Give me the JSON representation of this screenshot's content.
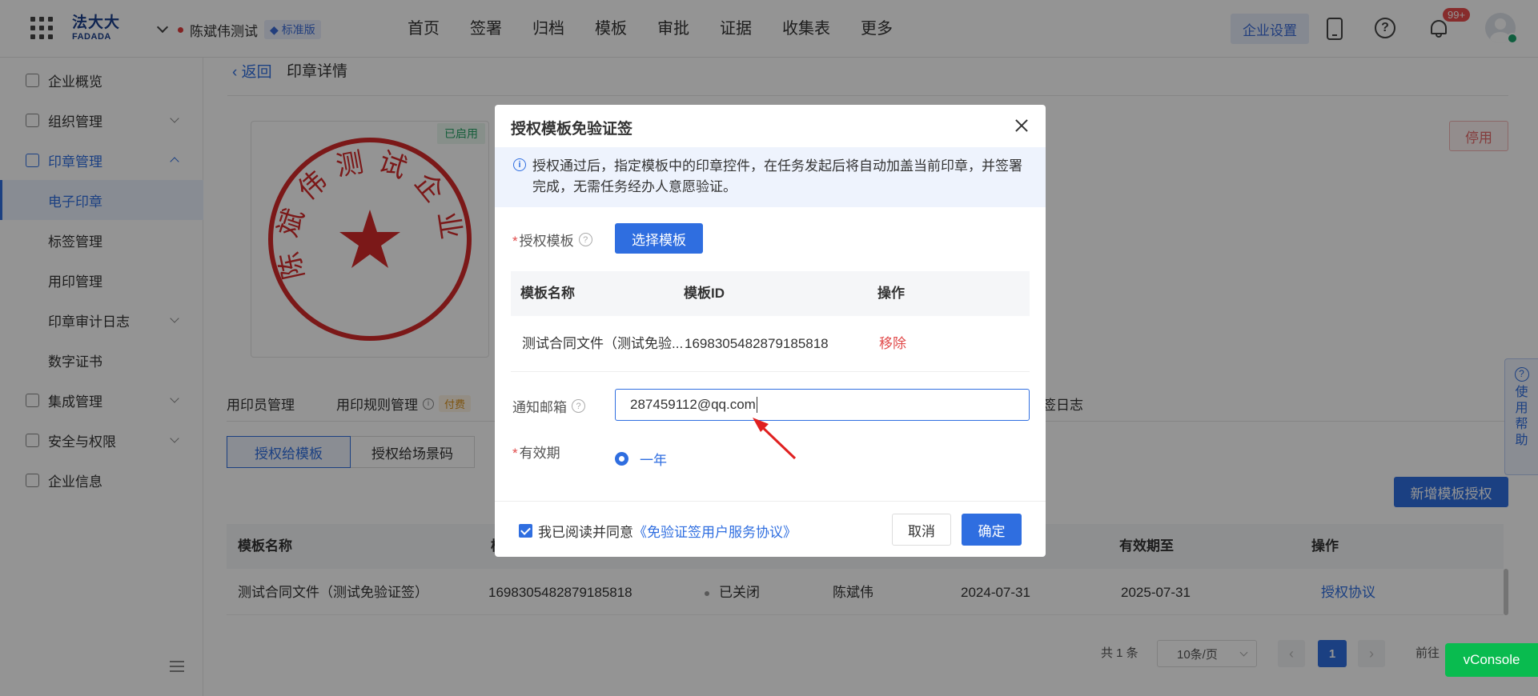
{
  "header": {
    "logo_cn": "法大大",
    "logo_en": "FADADA",
    "org_name": "陈斌伟测试",
    "edition_badge": "标准版",
    "nav": [
      "首页",
      "签署",
      "归档",
      "模板",
      "审批",
      "证据",
      "收集表",
      "更多"
    ],
    "enterprise_settings": "企业设置",
    "notification_count": "99+"
  },
  "sidebar": {
    "items": [
      {
        "label": "企业概览"
      },
      {
        "label": "组织管理"
      },
      {
        "label": "印章管理"
      },
      {
        "label": "电子印章"
      },
      {
        "label": "标签管理"
      },
      {
        "label": "用印管理"
      },
      {
        "label": "印章审计日志"
      },
      {
        "label": "数字证书"
      },
      {
        "label": "集成管理"
      },
      {
        "label": "安全与权限"
      },
      {
        "label": "企业信息"
      }
    ]
  },
  "page": {
    "back": "返回",
    "title": "印章详情",
    "seal_status": "已启用",
    "disable_button": "停用",
    "seal_text": "陈斌伟测试企业",
    "tabs": [
      "用印员管理",
      "用印规则管理",
      "签日志"
    ],
    "paid_tag": "付费",
    "segments": [
      "授权给模板",
      "授权给场景码"
    ],
    "add_button": "新增模板授权",
    "table": {
      "headers": [
        "模板名称",
        "模",
        "有效期至",
        "操作"
      ],
      "row": {
        "name": "测试合同文件（测试免验证签）",
        "id": "1698305482879185818",
        "status": "已关闭",
        "user": "陈斌伟",
        "start": "2024-07-31",
        "end": "2025-07-31",
        "action": "授权协议"
      }
    },
    "pagination": {
      "total": "共 1 条",
      "page_size": "10条/页",
      "current": "1",
      "goto": "前往"
    },
    "help": "使用帮助",
    "vconsole": "vConsole"
  },
  "modal": {
    "title": "授权模板免验证签",
    "info": "授权通过后，指定模板中的印章控件，在任务发起后将自动加盖当前印章，并签署完成，无需任务经办人意愿验证。",
    "template_label": "授权模板",
    "choose_button": "选择模板",
    "table_headers": [
      "模板名称",
      "模板ID",
      "操作"
    ],
    "row": {
      "name": "测试合同文件（测试免验...",
      "id": "1698305482879185818",
      "action": "移除"
    },
    "email_label": "通知邮箱",
    "email_value": "287459112@qq.com",
    "validity_label": "有效期",
    "validity_option": "一年",
    "agree_text": "我已阅读并同意",
    "agree_link": "《免验证签用户服务协议》",
    "cancel": "取消",
    "confirm": "确定"
  },
  "colors": {
    "primary": "#2f6ee0",
    "danger": "#e14b4b",
    "seal_red": "#d42a2a"
  }
}
